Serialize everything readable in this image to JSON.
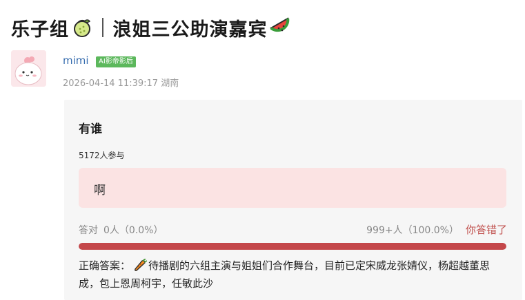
{
  "post": {
    "title_part1": "乐子组",
    "title_part2": "浪姐三公助演嘉宾",
    "icon_after_part1": "lemon-icon",
    "icon_after_part2": "watermelon-icon"
  },
  "author": {
    "name": "mimi",
    "badge": "AI影帝影后",
    "meta": "2026-04-14 11:39:17 湖南"
  },
  "quiz": {
    "question": "有谁",
    "participants": "5172人参与",
    "option": {
      "label": "啊",
      "fill_percent": 100
    },
    "correct_label": "答对",
    "correct_count": "0人（0.0%）",
    "answer_count": "999+人（100.0%）",
    "wrong_text": "你答错了",
    "answer_prefix": "正确答案：",
    "answer_icon": "carrot-icon",
    "answer_text": "待播剧的六组主演与姐姐们合作舞台，目前已定宋威龙张婧仪，杨超越董思成，包上恩周柯宇，任敏此沙"
  },
  "colors": {
    "accent_red": "#c4474a",
    "option_bg": "#fbe3e3",
    "badge_green": "#5cb85c",
    "link_blue": "#3a6fb0"
  }
}
